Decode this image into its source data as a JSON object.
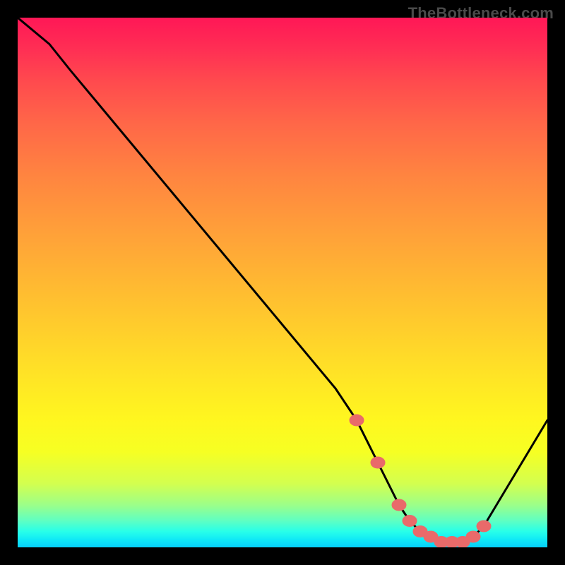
{
  "watermark": "TheBottleneck.com",
  "chart_data": {
    "type": "line",
    "title": "",
    "xlabel": "",
    "ylabel": "",
    "xlim": [
      0,
      100
    ],
    "ylim": [
      0,
      100
    ],
    "series": [
      {
        "name": "bottleneck-curve",
        "x": [
          0,
          6,
          10,
          20,
          30,
          40,
          50,
          60,
          64,
          68,
          70,
          72,
          74,
          76,
          78,
          80,
          82,
          84,
          86,
          88,
          94,
          100
        ],
        "values": [
          100,
          95,
          90,
          78,
          66,
          54,
          42,
          30,
          24,
          16,
          12,
          8,
          5,
          3,
          2,
          1,
          1,
          1,
          2,
          4,
          14,
          24
        ]
      }
    ],
    "markers": {
      "name": "optimal-range",
      "x": [
        64,
        68,
        72,
        74,
        76,
        78,
        80,
        82,
        84,
        86,
        88
      ],
      "values": [
        24,
        16,
        8,
        5,
        3,
        2,
        1,
        1,
        1,
        2,
        4
      ]
    },
    "gradient_stops": [
      {
        "pos": 0,
        "color": "#ff1756"
      },
      {
        "pos": 0.5,
        "color": "#ffc22f"
      },
      {
        "pos": 0.82,
        "color": "#f6ff23"
      },
      {
        "pos": 0.95,
        "color": "#5effc3"
      },
      {
        "pos": 1.0,
        "color": "#06cff9"
      }
    ]
  }
}
